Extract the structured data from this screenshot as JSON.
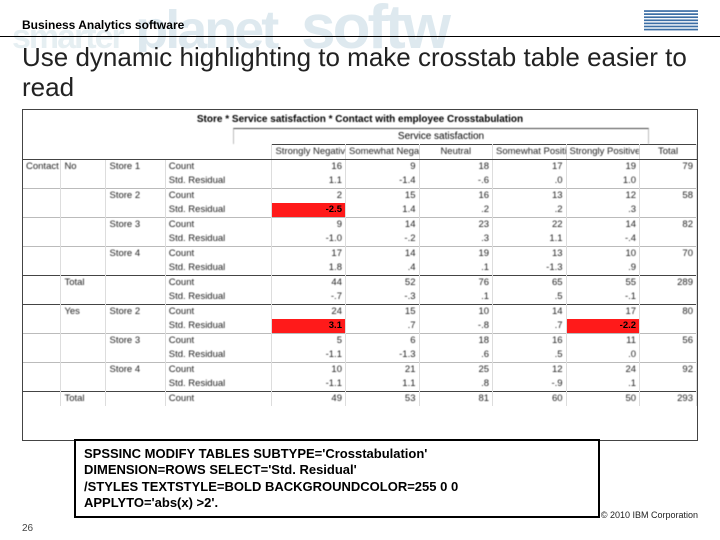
{
  "header": {
    "brand": "Business Analytics software"
  },
  "title": "Use dynamic highlighting to make crosstab table easier to read",
  "table": {
    "caption": "Store * Service satisfaction * Contact with employee Crosstabulation",
    "super_header": "Service satisfaction",
    "columns": [
      "Strongly Negative",
      "Somewhat Negative",
      "Neutral",
      "Somewhat Positive",
      "Strongly Positive",
      "Total"
    ],
    "stub_contact": "Contact with employee",
    "stub_store_label": "Store",
    "stats": {
      "count": "Count",
      "resid": "Std. Residual"
    },
    "stores": [
      "Store 1",
      "Store 2",
      "Store 3",
      "Store 4"
    ],
    "total_label": "Total",
    "sections": [
      {
        "contact": "No",
        "rows": [
          {
            "store": 0,
            "count": [
              "16",
              "9",
              "18",
              "17",
              "19",
              "79"
            ],
            "resid": [
              "1.1",
              "-1.4",
              "-.6",
              ".0",
              "1.0",
              ""
            ]
          },
          {
            "store": 1,
            "count": [
              "2",
              "15",
              "16",
              "13",
              "12",
              "58"
            ],
            "resid": [
              "-2.5",
              "1.4",
              ".2",
              ".2",
              ".3",
              ""
            ],
            "hl": [
              0
            ]
          },
          {
            "store": 2,
            "count": [
              "9",
              "14",
              "23",
              "22",
              "14",
              "82"
            ],
            "resid": [
              "-1.0",
              "-.2",
              ".3",
              "1.1",
              "-.4",
              ""
            ]
          },
          {
            "store": 3,
            "count": [
              "17",
              "14",
              "19",
              "13",
              "10",
              "70"
            ],
            "resid_hidden": true,
            "resid": [
              "1.8",
              ".4",
              ".1",
              "-1.3",
              ".9",
              ""
            ]
          }
        ],
        "total": {
          "count": [
            "44",
            "52",
            "76",
            "65",
            "55",
            "289"
          ],
          "resid": [
            "-.7",
            "-.3",
            ".1",
            ".5",
            "-.1",
            ""
          ]
        }
      },
      {
        "contact": "Yes",
        "rows": [
          {
            "store": 1,
            "count": [
              "24",
              "15",
              "10",
              "14",
              "17",
              "80"
            ],
            "resid": [
              "3.1",
              ".7",
              "-.8",
              ".7",
              "-2.2",
              ""
            ],
            "hl": [
              0,
              4
            ]
          },
          {
            "store": 2,
            "count": [
              "5",
              "6",
              "18",
              "16",
              "11",
              "56"
            ],
            "resid": [
              "-1.1",
              "-1.3",
              ".6",
              ".5",
              ".0",
              ""
            ]
          },
          {
            "store": 3,
            "count": [
              "10",
              "21",
              "25",
              "12",
              "24",
              "92"
            ],
            "resid": [
              "-1.1",
              "1.1",
              ".8",
              "-.9",
              ".1",
              ""
            ]
          }
        ],
        "total": {
          "count": [
            "49",
            "53",
            "81",
            "60",
            "50",
            "293"
          ]
        }
      }
    ]
  },
  "code": [
    "SPSSINC MODIFY TABLES SUBTYPE='Crosstabulation'",
    "DIMENSION=ROWS SELECT='Std. Residual'",
    "/STYLES TEXTSTYLE=BOLD BACKGROUNDCOLOR=255 0 0",
    "APPLYTO='abs(x) >2'."
  ],
  "footer": {
    "page": "26",
    "copyright": "© 2010 IBM Corporation"
  }
}
